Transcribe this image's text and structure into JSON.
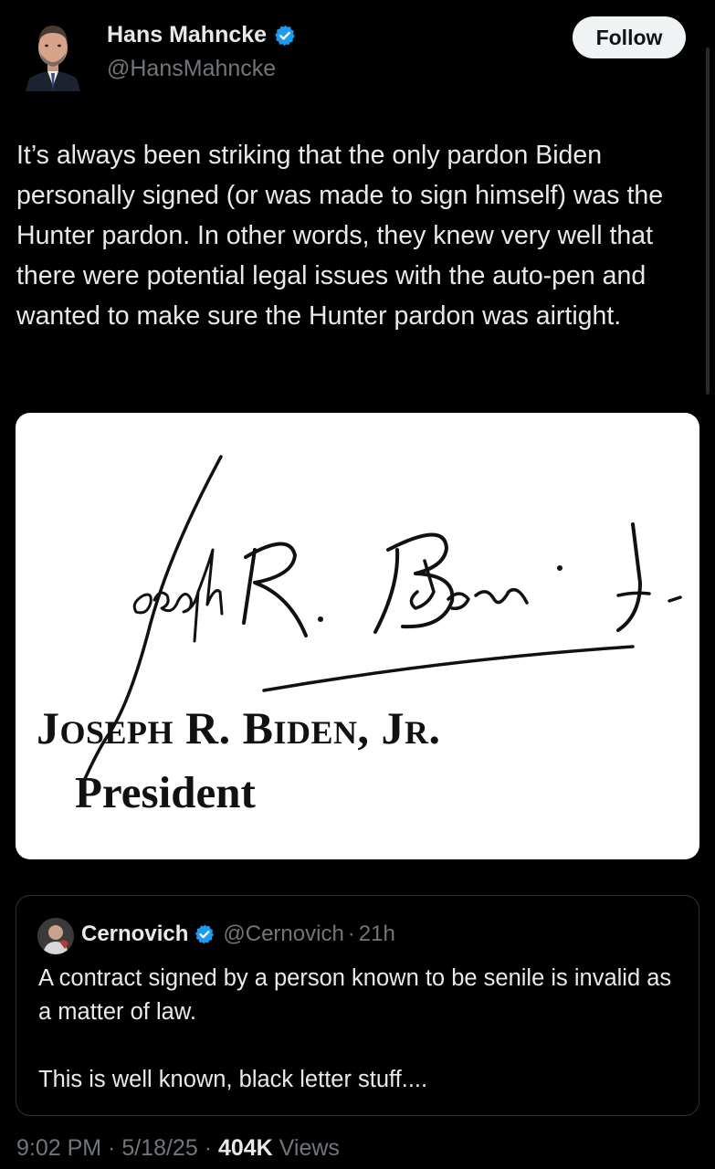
{
  "author": {
    "name": "Hans Mahncke",
    "handle": "@HansMahncke",
    "verified": true,
    "avatar_icon": "person-avatar"
  },
  "follow_button": {
    "label": "Follow"
  },
  "tweet": {
    "text": "It’s always been striking that the only pardon Biden personally signed (or was made to sign himself) was the Hunter pardon. In other words, they knew very well that there were potential legal issues with the auto-pen and wanted to make sure the Hunter pardon was airtight."
  },
  "media": {
    "type": "signature-image",
    "caption_name_parts": [
      "J",
      "OSEPH",
      " R. ",
      "B",
      "IDEN",
      ", ",
      "J",
      "R",
      "."
    ],
    "caption_title": "President",
    "background": "#ffffff"
  },
  "quote": {
    "name": "Cernovich",
    "verified": true,
    "handle": "@Cernovich",
    "separator": "·",
    "time": "21h",
    "text": "A contract signed by a person known to be senile is invalid as a matter of law.\n\nThis is well known, black letter stuff...."
  },
  "meta": {
    "time": "9:02 PM",
    "separator": " · ",
    "date": "5/18/25",
    "views_count": "404K",
    "views_label": " Views"
  },
  "colors": {
    "background": "#000000",
    "text_primary": "#e7e9ea",
    "text_secondary": "#71767b",
    "verified_blue": "#1d9bf0",
    "border": "#2f3336",
    "follow_bg": "#eff3f4"
  }
}
